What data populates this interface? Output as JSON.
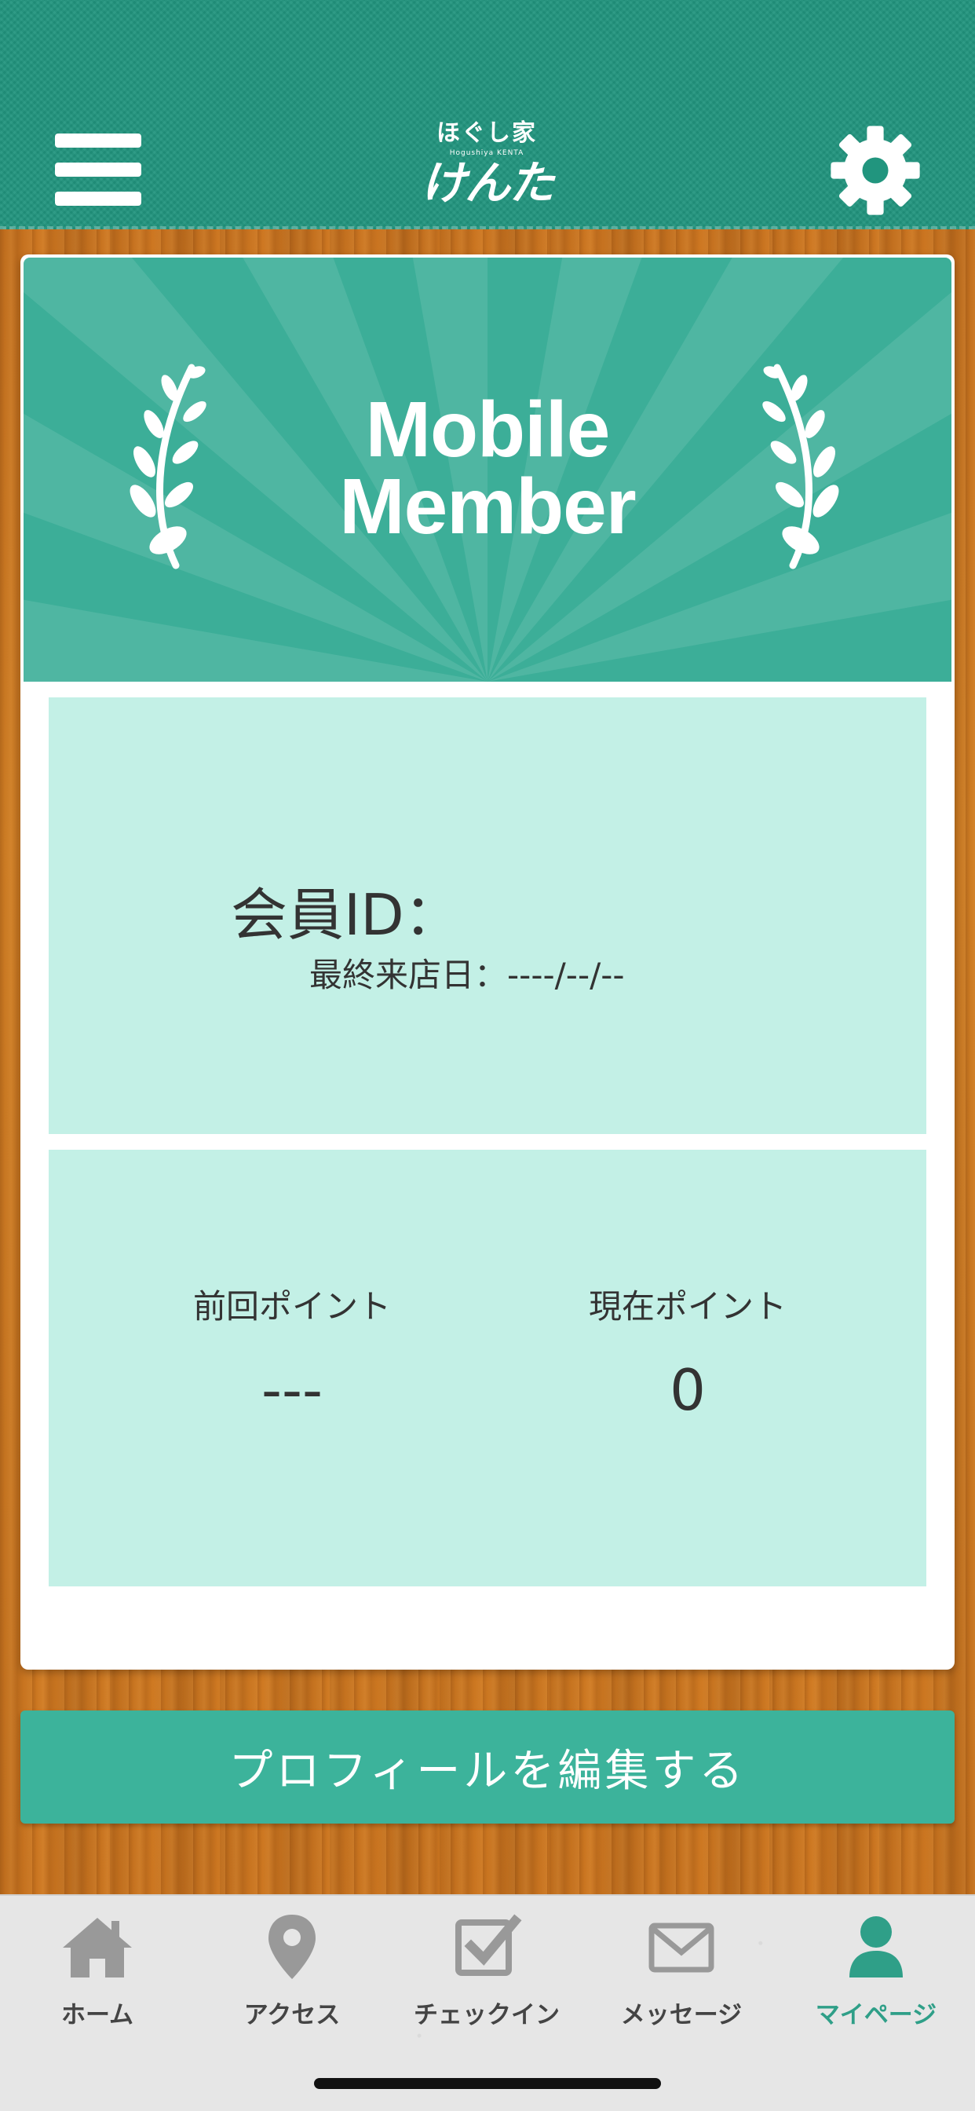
{
  "header": {
    "logo_top": "ほぐし家",
    "logo_roman": "Hogushiya KENTA",
    "logo_main": "けんた"
  },
  "banner": {
    "line1": "Mobile",
    "line2": "Member"
  },
  "member": {
    "id_label": "会員ID：",
    "id_value": "",
    "last_visit_label": "最終来店日：",
    "last_visit_value": "----/--/--"
  },
  "points": {
    "previous_label": "前回ポイント",
    "previous_value": "---",
    "current_label": "現在ポイント",
    "current_value": "0"
  },
  "edit_button_label": "プロフィールを編集する",
  "tabs": [
    {
      "label": "ホーム",
      "icon": "home-icon"
    },
    {
      "label": "アクセス",
      "icon": "map-pin-icon"
    },
    {
      "label": "チェックイン",
      "icon": "checkbox-icon"
    },
    {
      "label": "メッセージ",
      "icon": "envelope-icon"
    },
    {
      "label": "マイページ",
      "icon": "user-icon",
      "active": true
    }
  ],
  "colors": {
    "header": "#21957e",
    "banner": "#3cae98",
    "panel": "#c3f0e6",
    "button": "#3cb39b",
    "active_tab": "#2f9f88",
    "inactive_tab": "#999999"
  }
}
